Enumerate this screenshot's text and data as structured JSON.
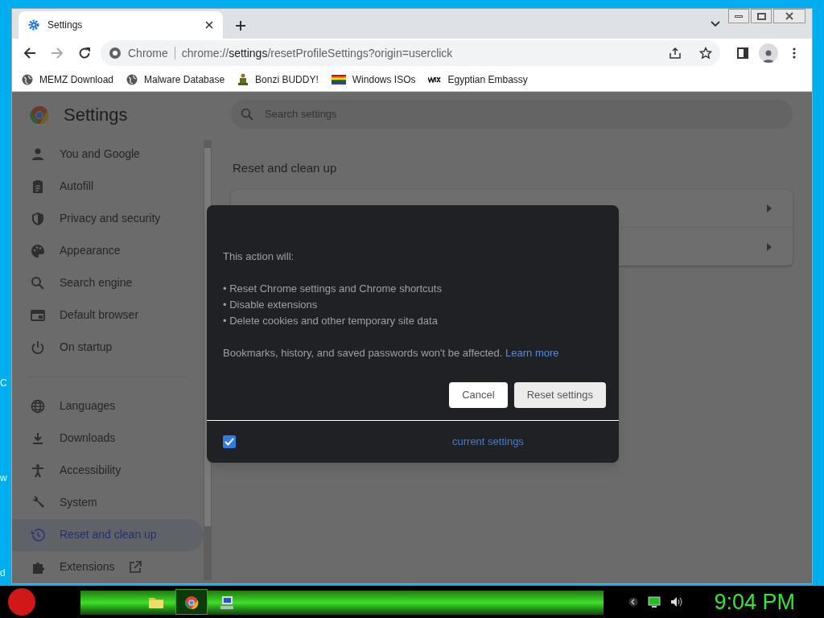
{
  "desktop_labels": [
    "C",
    "w",
    "d"
  ],
  "tabs": [
    {
      "title": "Settings",
      "selected": true
    }
  ],
  "address": {
    "site_label": "Chrome",
    "url": "chrome://**settings**/resetProfileSettings?origin=userclick"
  },
  "bookmarks": [
    {
      "label": "MEMZ Download",
      "kind": "globe"
    },
    {
      "label": "Malware Database",
      "kind": "globe"
    },
    {
      "label": "Bonzi BUDDY!",
      "kind": "figure"
    },
    {
      "label": "Windows ISOs",
      "kind": "rainbow"
    },
    {
      "label": "Egyptian Embassy",
      "kind": "wix"
    }
  ],
  "settings": {
    "title": "Settings",
    "search_placeholder": "Search settings",
    "nav_groups": [
      [
        {
          "label": "You and Google",
          "kind": "person",
          "selected": false
        },
        {
          "label": "Autofill",
          "kind": "clipboard",
          "selected": false
        },
        {
          "label": "Privacy and security",
          "kind": "shield",
          "selected": false
        },
        {
          "label": "Appearance",
          "kind": "palette",
          "selected": false
        },
        {
          "label": "Search engine",
          "kind": "search",
          "selected": false
        },
        {
          "label": "Default browser",
          "kind": "browser",
          "selected": false
        },
        {
          "label": "On startup",
          "kind": "power",
          "selected": false
        }
      ],
      [
        {
          "label": "Languages",
          "kind": "globe",
          "selected": false
        },
        {
          "label": "Downloads",
          "kind": "download",
          "selected": false
        },
        {
          "label": "Accessibility",
          "kind": "accessibility",
          "selected": false
        },
        {
          "label": "System",
          "kind": "wrench",
          "selected": false
        },
        {
          "label": "Reset and clean up",
          "kind": "history",
          "selected": true
        },
        {
          "label": "Extensions",
          "kind": "puzzle",
          "selected": false,
          "external": true
        }
      ]
    ],
    "section_title": "Reset and clean up"
  },
  "dialog": {
    "intro": "This action will:",
    "bullets": [
      "• Reset Chrome settings and Chrome shortcuts",
      "• Disable extensions",
      "• Delete cookies and other temporary site data"
    ],
    "note": "Bookmarks, history, and saved passwords won't be affected.",
    "link": "Learn more",
    "buttons": [
      {
        "label": "Cancel",
        "kind": "secondary"
      },
      {
        "label": "Reset settings",
        "kind": "primary"
      }
    ],
    "footer": {
      "checked": true,
      "link": "current settings"
    }
  },
  "taskbar": {
    "apps": [
      {
        "kind": "folder",
        "selected": false
      },
      {
        "kind": "chrome",
        "selected": true
      },
      {
        "kind": "computer",
        "selected": false
      }
    ],
    "clock": "9:04 PM"
  }
}
